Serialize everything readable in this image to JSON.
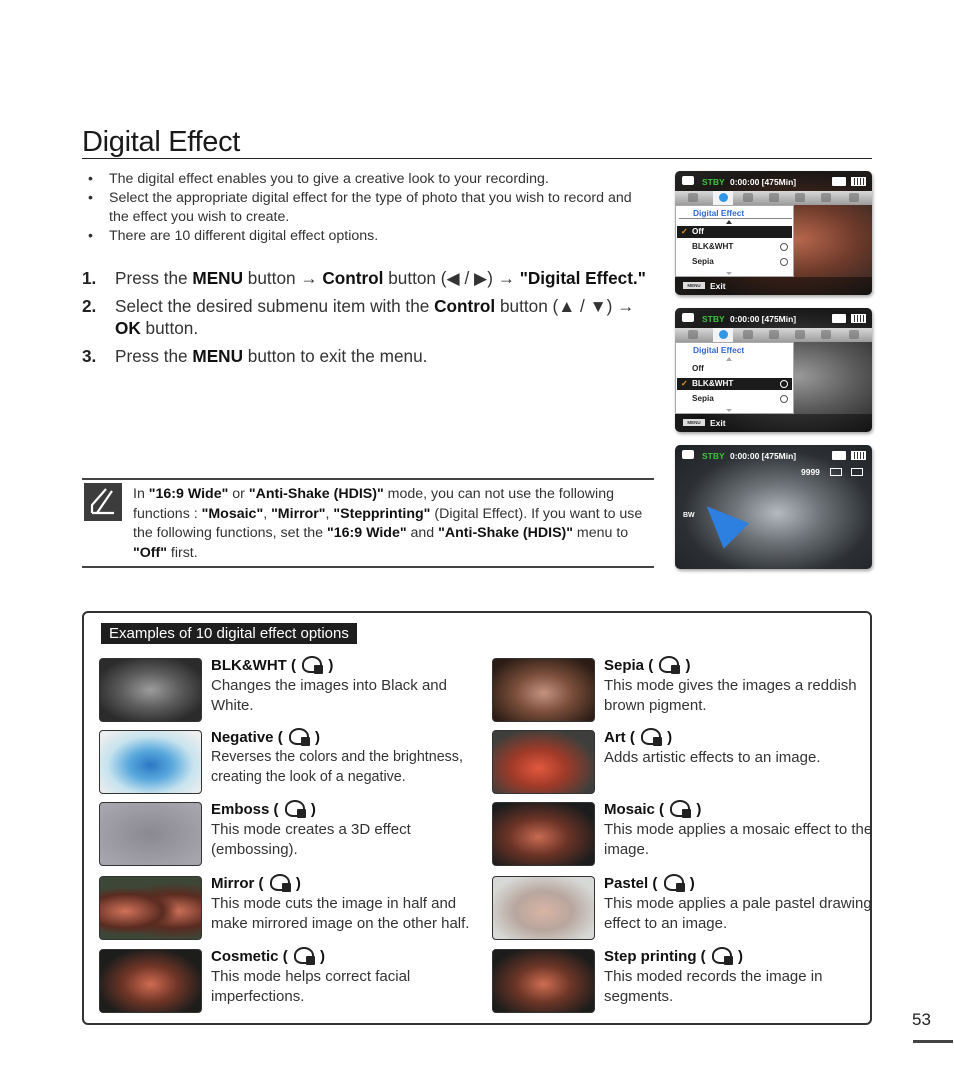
{
  "page": {
    "title": "Digital Effect",
    "page_number": "53"
  },
  "bullets": [
    "The digital effect enables you to give a creative look to your recording.",
    "Select the appropriate digital effect for the type of photo that you wish to record and the effect you wish to create.",
    "There are 10 different digital effect options."
  ],
  "steps": [
    {
      "num": "1.",
      "parts": [
        {
          "t": "Press the ",
          "b": false
        },
        {
          "t": "MENU",
          "b": true
        },
        {
          "t": " button → ",
          "b": false
        },
        {
          "t": "Control",
          "b": true
        },
        {
          "t": " button (◀ / ▶) → ",
          "b": false
        },
        {
          "t": "\"Digital Effect.\"",
          "b": true
        }
      ]
    },
    {
      "num": "2.",
      "parts": [
        {
          "t": "Select the desired submenu item with the ",
          "b": false
        },
        {
          "t": "Control",
          "b": true
        },
        {
          "t": " button (▲ / ▼) → ",
          "b": false
        },
        {
          "t": "OK",
          "b": true
        },
        {
          "t": " button.",
          "b": false
        }
      ]
    },
    {
      "num": "3.",
      "parts": [
        {
          "t": "Press the ",
          "b": false
        },
        {
          "t": "MENU",
          "b": true
        },
        {
          "t": " button to exit the menu.",
          "b": false
        }
      ]
    }
  ],
  "note": {
    "icon": "note-pencil-icon",
    "parts": [
      {
        "t": "In ",
        "b": false
      },
      {
        "t": "\"16:9 Wide\"",
        "b": true
      },
      {
        "t": " or ",
        "b": false
      },
      {
        "t": "\"Anti-Shake (HDIS)\"",
        "b": true
      },
      {
        "t": " mode, you can not use the following functions : ",
        "b": false
      },
      {
        "t": "\"Mosaic\"",
        "b": true
      },
      {
        "t": ", ",
        "b": false
      },
      {
        "t": "\"Mirror\"",
        "b": true
      },
      {
        "t": ", ",
        "b": false
      },
      {
        "t": "\"Stepprinting\"",
        "b": true
      },
      {
        "t": " (Digital Effect). If you want to use the following functions, set the ",
        "b": false
      },
      {
        "t": "\"16:9 Wide\"",
        "b": true
      },
      {
        "t": " and ",
        "b": false
      },
      {
        "t": "\"Anti-Shake (HDIS)\"",
        "b": true
      },
      {
        "t": " menu to ",
        "b": false
      },
      {
        "t": "\"Off\"",
        "b": true
      },
      {
        "t": " first.",
        "b": false
      }
    ]
  },
  "screens": [
    {
      "status": {
        "stby": "STBY",
        "time": "0:00:00 [475Min]"
      },
      "menu": {
        "title": "Digital Effect",
        "items": [
          {
            "label": "Off",
            "selected": true
          },
          {
            "label": "BLK&WHT",
            "selected": false
          },
          {
            "label": "Sepia",
            "selected": false
          }
        ]
      },
      "footer": {
        "menu_button": "MENU",
        "exit": "Exit"
      }
    },
    {
      "status": {
        "stby": "STBY",
        "time": "0:00:00 [475Min]"
      },
      "menu": {
        "title": "Digital Effect",
        "items": [
          {
            "label": "Off",
            "selected": false
          },
          {
            "label": "BLK&WHT",
            "selected": true
          },
          {
            "label": "Sepia",
            "selected": false
          }
        ]
      },
      "footer": {
        "menu_button": "MENU",
        "exit": "Exit"
      }
    },
    {
      "status": {
        "stby": "STBY",
        "time": "0:00:00 [475Min]"
      },
      "count": "9999",
      "effect_indicator": "BW"
    }
  ],
  "examples": {
    "heading": "Examples of 10 digital effect options",
    "items": [
      {
        "name": "BLK&WHT",
        "desc": "Changes the images into Black and White.",
        "thumb": "t-bw",
        "icon": "bw-effect-icon"
      },
      {
        "name": "Negative",
        "desc": "Reverses the colors and the brightness, creating the look of a negative.",
        "thumb": "t-neg",
        "icon": "negative-effect-icon"
      },
      {
        "name": "Emboss",
        "desc": "This mode creates a 3D effect (embossing).",
        "thumb": "t-emb",
        "icon": "emboss-effect-icon"
      },
      {
        "name": "Mirror",
        "desc": "This mode cuts the image in half and make mirrored image on the other half.",
        "thumb": "t-mir",
        "icon": "mirror-effect-icon"
      },
      {
        "name": "Cosmetic",
        "desc": "This mode helps correct facial imperfections.",
        "thumb": "t-cos",
        "icon": "cosmetic-effect-icon"
      },
      {
        "name": "Sepia",
        "desc": "This mode gives the images a reddish brown pigment.",
        "thumb": "t-sep",
        "icon": "sepia-effect-icon"
      },
      {
        "name": "Art",
        "desc": "Adds artistic effects to an image.",
        "thumb": "t-art",
        "icon": "art-effect-icon"
      },
      {
        "name": "Mosaic",
        "desc": "This mode applies a mosaic effect to the image.",
        "thumb": "t-mos",
        "icon": "mosaic-effect-icon"
      },
      {
        "name": "Pastel",
        "desc": "This mode applies a pale pastel drawing effect to an image.",
        "thumb": "t-pas",
        "icon": "pastel-effect-icon"
      },
      {
        "name": "Step printing",
        "desc": "This moded records the image in segments.",
        "thumb": "t-step",
        "icon": "step-printing-effect-icon"
      }
    ]
  }
}
